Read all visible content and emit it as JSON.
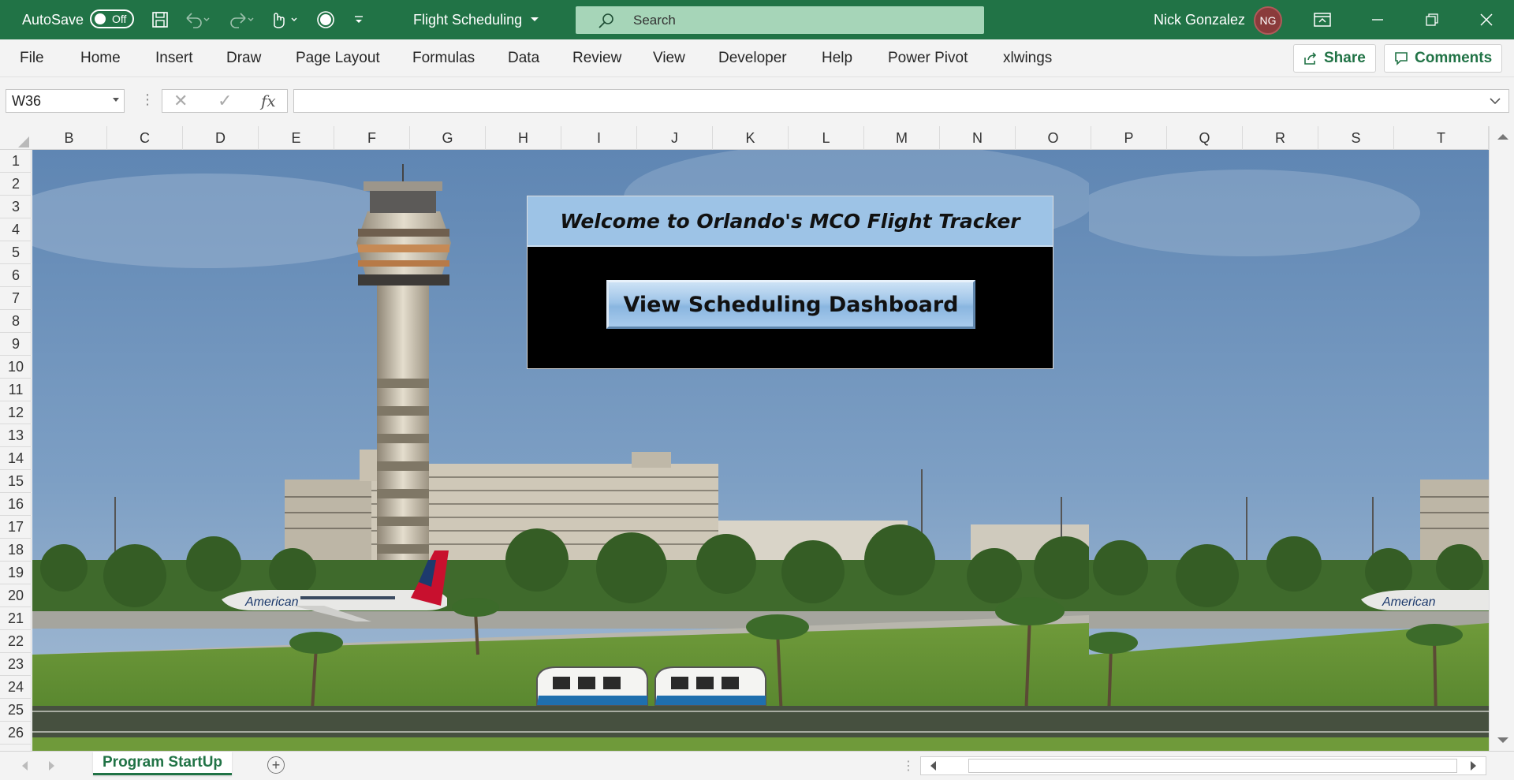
{
  "colors": {
    "excel_green": "#217346",
    "search_bg": "#a6d5b8",
    "panel_header": "#9dc3e6",
    "avatar_bg": "#8a3b3b"
  },
  "titlebar": {
    "autosave_label": "AutoSave",
    "autosave_state": "Off",
    "doc_title": "Flight Scheduling",
    "search_placeholder": "Search",
    "user_name": "Nick Gonzalez",
    "user_initials": "NG",
    "icons": [
      "save-icon",
      "undo-icon",
      "redo-icon",
      "touch-mode-icon",
      "circle-icon",
      "customize-toolbar-icon",
      "ribbon-display-icon",
      "minimize-icon",
      "restore-icon",
      "close-icon"
    ]
  },
  "ribbon": {
    "tabs": [
      "File",
      "Home",
      "Insert",
      "Draw",
      "Page Layout",
      "Formulas",
      "Data",
      "Review",
      "View",
      "Developer",
      "Help",
      "Power Pivot",
      "xlwings"
    ],
    "share_label": "Share",
    "comments_label": "Comments"
  },
  "formula_bar": {
    "name_box": "W36",
    "fx_label": "fx",
    "formula": ""
  },
  "grid": {
    "columns": [
      "B",
      "C",
      "D",
      "E",
      "F",
      "G",
      "H",
      "I",
      "J",
      "K",
      "L",
      "M",
      "N",
      "O",
      "P",
      "Q",
      "R",
      "S",
      "T"
    ],
    "rows": [
      "1",
      "2",
      "3",
      "4",
      "5",
      "6",
      "7",
      "8",
      "9",
      "10",
      "11",
      "12",
      "13",
      "14",
      "15",
      "16",
      "17",
      "18",
      "19",
      "20",
      "21",
      "22",
      "23",
      "24",
      "25",
      "26"
    ]
  },
  "welcome_panel": {
    "title": "Welcome to Orlando's MCO Flight Tracker",
    "button_label": "View Scheduling Dashboard"
  },
  "picture": {
    "plane_livery_text": "American"
  },
  "sheet_tabs": {
    "active": "Program StartUp"
  }
}
